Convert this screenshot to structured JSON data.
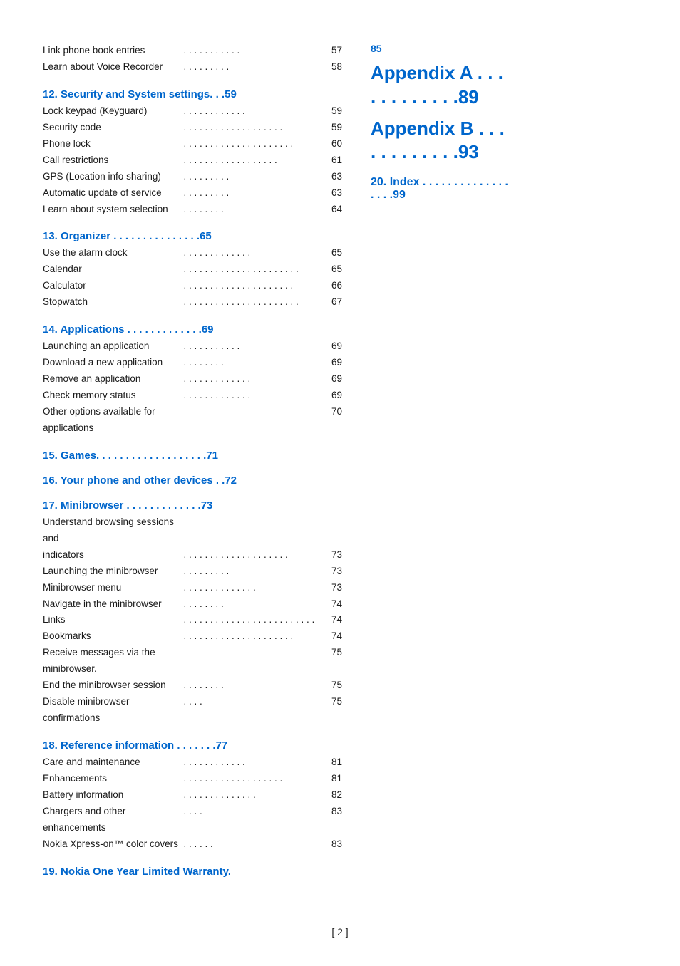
{
  "left": {
    "sections": [
      {
        "id": "sec12",
        "header": "12.  Security and System settings. . .59",
        "entries": [
          {
            "text": "Lock keypad (Keyguard)",
            "dots": " . . . . . . . . . . . .",
            "page": "59"
          },
          {
            "text": "Security code",
            "dots": ". . . . . . . . . . . . . . . . . . .",
            "page": "59"
          },
          {
            "text": "Phone lock",
            "dots": ". . . . . . . . . . . . . . . . . . . . .",
            "page": "60"
          },
          {
            "text": "Call restrictions",
            "dots": ". . . . . . . . . . . . . . . . . .",
            "page": "61"
          },
          {
            "text": "GPS (Location info sharing)",
            "dots": " . . . . . . . . .",
            "page": "63"
          },
          {
            "text": "Automatic update of service",
            "dots": " . . . . . . . . .",
            "page": "63"
          },
          {
            "text": "Learn about system selection",
            "dots": "  . . . . . . . .",
            "page": "64"
          }
        ]
      },
      {
        "id": "sec13",
        "header": "13.  Organizer  . . . . . . . . . . . . . . .65",
        "entries": [
          {
            "text": "Use the alarm clock",
            "dots": " . . . . . . . . . . . . .",
            "page": "65"
          },
          {
            "text": "Calendar",
            "dots": " . . . . . . . . . . . . . . . . . . . . . .",
            "page": "65"
          },
          {
            "text": "Calculator",
            "dots": " . . . . . . . . . . . . . . . . . . . . .",
            "page": "66"
          },
          {
            "text": "Stopwatch",
            "dots": ". . . . . . . . . . . . . . . . . . . . . .",
            "page": "67"
          }
        ]
      },
      {
        "id": "sec14",
        "header": "14.  Applications  . . . . . . . . . . . . .69",
        "entries": [
          {
            "text": "Launching an application",
            "dots": ". . . . . . . . . . .",
            "page": "69"
          },
          {
            "text": "Download a new application",
            "dots": " . . . . . . . .",
            "page": "69"
          },
          {
            "text": "Remove an application",
            "dots": ". . . . . . . . . . . . .",
            "page": "69"
          },
          {
            "text": "Check memory status",
            "dots": ". . . . . . . . . . . . .",
            "page": "69"
          },
          {
            "text": "Other options available for applications",
            "dots": "",
            "page": "70"
          }
        ]
      },
      {
        "id": "sec15",
        "header": "15.  Games. . . . . . . . . . . . . . . . . . .71"
      },
      {
        "id": "sec16",
        "header": "16.  Your phone and other devices . .72"
      },
      {
        "id": "sec17",
        "header": "17.  Minibrowser  . . . . . . . . . . . . .73",
        "entries": [
          {
            "text": "Understand browsing sessions and",
            "dots": "",
            "page": ""
          },
          {
            "text": "    indicators",
            "dots": " . . . . . . . . . . . . . . . . . . . .",
            "page": "73"
          },
          {
            "text": "Launching the minibrowser",
            "dots": ". . . . . . . . .",
            "page": "73"
          },
          {
            "text": "Minibrowser menu",
            "dots": " . . . . . . . . . . . . . .",
            "page": "73"
          },
          {
            "text": "Navigate in the minibrowser",
            "dots": ". . . . . . . .",
            "page": "74"
          },
          {
            "text": "Links",
            "dots": ". . . . . . . . . . . . . . . . . . . . . . . . .",
            "page": "74"
          },
          {
            "text": "Bookmarks",
            "dots": ". . . . . . . . . . . . . . . . . . . . .",
            "page": "74"
          },
          {
            "text": "Receive messages via the minibrowser.",
            "dots": "",
            "page": "75"
          },
          {
            "text": "End the minibrowser session",
            "dots": " . . . . . . . .",
            "page": "75"
          },
          {
            "text": "Disable minibrowser confirmations",
            "dots": ". . . .",
            "page": "75"
          }
        ]
      },
      {
        "id": "sec18",
        "header": "18.  Reference information  . . . . . . .77",
        "entries": [
          {
            "text": "Care and maintenance",
            "dots": " . . . . . . . . . . . .",
            "page": "81"
          },
          {
            "text": "Enhancements",
            "dots": ". . . . . . . . . . . . . . . . . . .",
            "page": "81"
          },
          {
            "text": "Battery information",
            "dots": " . . . . . . . . . . . . . .",
            "page": "82"
          },
          {
            "text": "Chargers and other enhancements",
            "dots": " . . . .",
            "page": "83"
          },
          {
            "text": "Nokia Xpress-on™ color covers",
            "dots": " . . . . . .",
            "page": "83"
          }
        ]
      },
      {
        "id": "sec19",
        "header": "19.  Nokia One Year Limited Warranty."
      }
    ],
    "pre_entries": [
      {
        "text": "Link phone book entries",
        "dots": " . . . . . . . . . . .",
        "page": "57"
      },
      {
        "text": "Learn about Voice Recorder",
        "dots": ". . . . . . . . .",
        "page": "58"
      }
    ]
  },
  "right": {
    "appendix_number": "85",
    "appendix_a": "Appendix A",
    "appendix_a_dots": " . . . . . . . . . . . .",
    "appendix_a_page": "89",
    "appendix_b": "Appendix B",
    "appendix_b_dots": " . . . . . . . . . . . .",
    "appendix_b_page": "93",
    "index_label": "20.  Index",
    "index_dots": " . . . . . . . . . . . . . . . . . .",
    "index_page": "99"
  },
  "footer": {
    "text": "[ 2 ]"
  }
}
